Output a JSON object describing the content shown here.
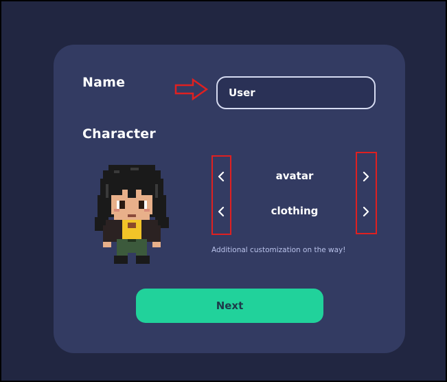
{
  "form": {
    "name_label": "Name",
    "name_value": "User",
    "character_label": "Character",
    "options": {
      "avatar_label": "avatar",
      "clothing_label": "clothing"
    },
    "note": "Additional customization on the way!",
    "next_label": "Next"
  },
  "icons": {
    "prev": "chevron-left-icon",
    "next": "chevron-right-icon",
    "annotation": "red-arrow-icon"
  },
  "colors": {
    "background": "#212641",
    "card": "#333b62",
    "button": "#21d29b",
    "annotation": "#e02020",
    "note_text": "#b9c2ea"
  }
}
